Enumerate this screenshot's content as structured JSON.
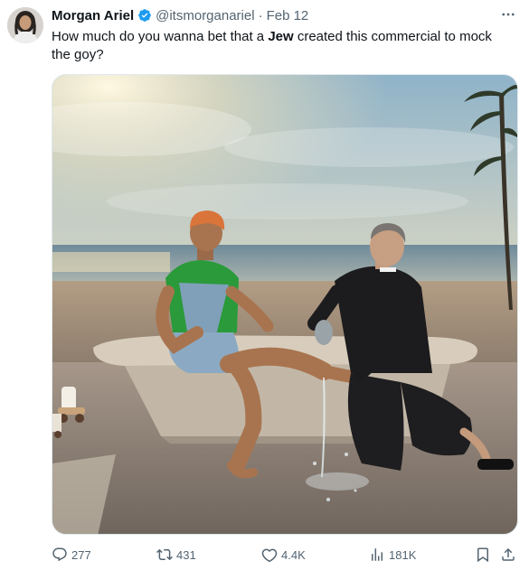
{
  "tweet": {
    "author": {
      "name": "Morgan Ariel",
      "handle": "@itsmorganariel",
      "verified": true
    },
    "separator": "·",
    "date": "Feb 12",
    "text_before": "How much do you wanna bet that a ",
    "text_bold": "Jew",
    "text_after": " created this commercial to mock the goy?",
    "media": {
      "kind": "photo"
    },
    "stats": {
      "replies": "277",
      "retweets": "431",
      "likes": "4.4K",
      "views": "181K"
    }
  },
  "colors": {
    "text": "#0f1419",
    "secondary": "#536471",
    "verified": "#1d9bf0"
  },
  "icons": {
    "more": "more-horizontal-icon",
    "verified": "verified-badge-icon",
    "reply": "reply-icon",
    "retweet": "retweet-icon",
    "like": "heart-icon",
    "views": "views-icon",
    "bookmark": "bookmark-icon",
    "share": "share-icon"
  }
}
